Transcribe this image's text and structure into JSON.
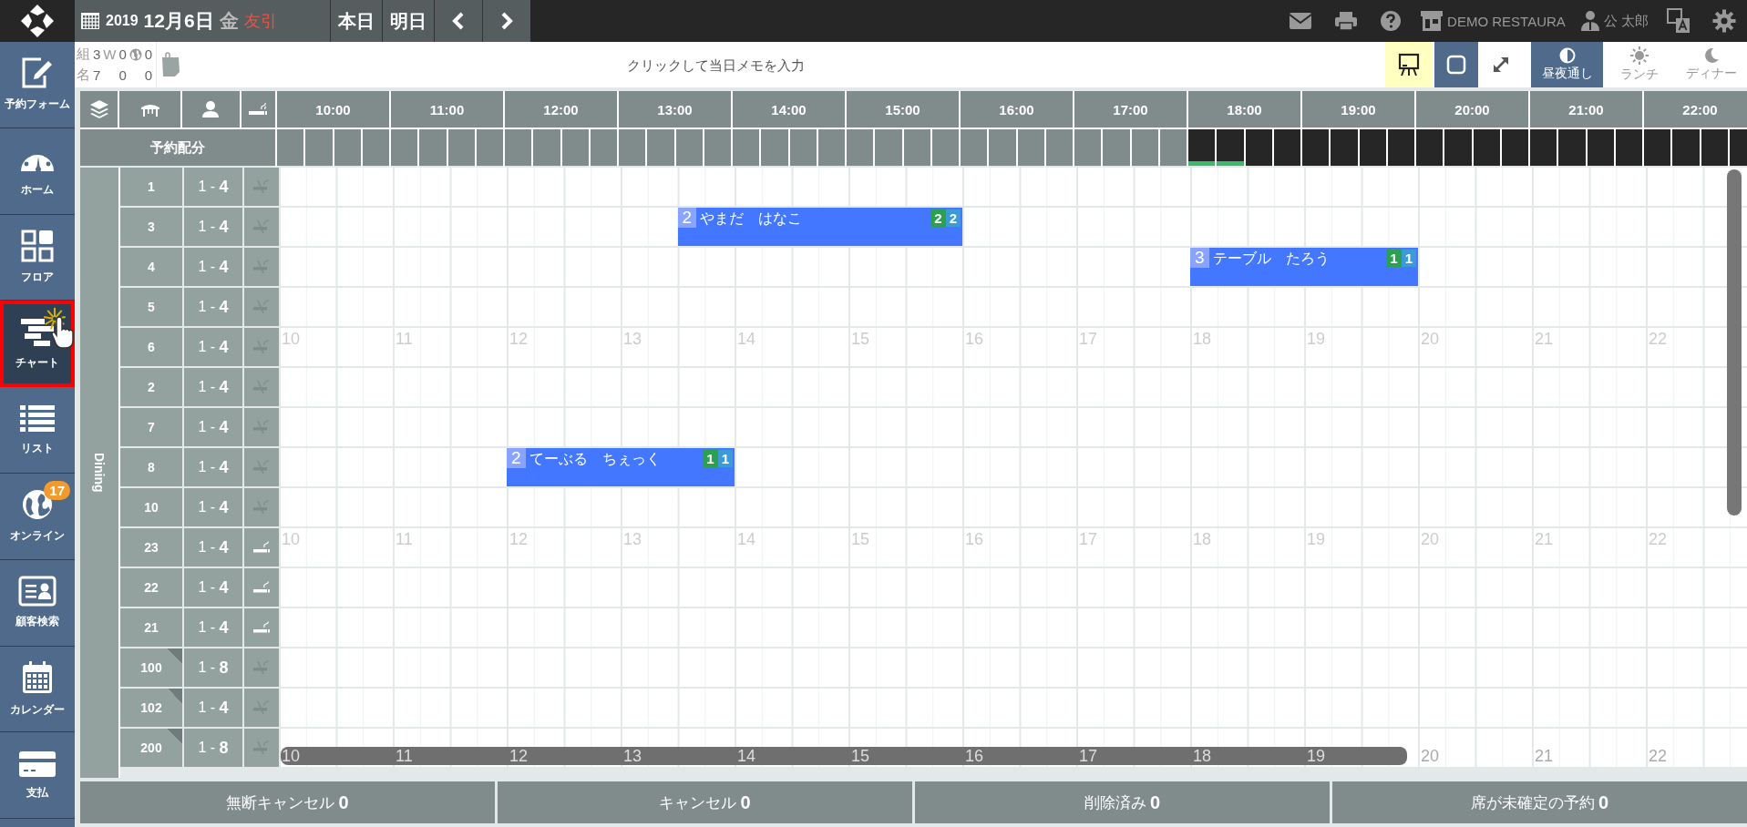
{
  "top_bar": {
    "year": "2019",
    "date": "12月6日",
    "weekday": "金",
    "rokuyo": "友引",
    "nav_buttons": [
      {
        "kind": "text",
        "label": "本日"
      },
      {
        "kind": "text",
        "label": "明日"
      },
      {
        "kind": "prev"
      },
      {
        "kind": "next"
      }
    ],
    "tools": [
      {
        "kind": "mail"
      },
      {
        "kind": "print"
      },
      {
        "kind": "help"
      },
      {
        "kind": "store",
        "label": "DEMO RESTAURA"
      },
      {
        "kind": "user",
        "label": "公 太郎"
      },
      {
        "kind": "translate"
      },
      {
        "kind": "settings"
      }
    ]
  },
  "sidebar": {
    "items": [
      {
        "kind": "form",
        "label": "予約フォーム",
        "selected": false
      },
      {
        "kind": "home",
        "label": "ホーム",
        "selected": false
      },
      {
        "kind": "floor",
        "label": "フロア",
        "selected": false
      },
      {
        "kind": "chart",
        "label": "チャート",
        "selected": true
      },
      {
        "kind": "list",
        "label": "リスト",
        "selected": false
      },
      {
        "kind": "online",
        "label": "オンライン",
        "selected": false,
        "badge": "17"
      },
      {
        "kind": "customer",
        "label": "顧客検索",
        "selected": false
      },
      {
        "kind": "calendar",
        "label": "カレンダー",
        "selected": false
      },
      {
        "kind": "payment",
        "label": "支払",
        "selected": false
      }
    ]
  },
  "summary": {
    "walkin_label": "W",
    "rows": [
      {
        "label": "組",
        "total": "3",
        "walkin": "0",
        "online": "0"
      },
      {
        "label": "名",
        "total": "7",
        "walkin": "0",
        "online": "0"
      }
    ]
  },
  "memo": {
    "placeholder": "クリックして当日メモを入力"
  },
  "view_buttons": [
    {
      "kind": "board"
    },
    {
      "kind": "square"
    },
    {
      "kind": "expand"
    }
  ],
  "periods": [
    {
      "kind": "both",
      "label": "昼夜通し",
      "selected": true
    },
    {
      "kind": "lunch",
      "label": "ランチ",
      "selected": false
    },
    {
      "kind": "dinner",
      "label": "ディナー",
      "selected": false
    }
  ],
  "chart": {
    "allocation_label": "予約配分",
    "area": "Dining",
    "hours": [
      {
        "label": "10:00",
        "slots": [
          {
            "closed": false,
            "booked": false
          },
          {
            "closed": false,
            "booked": false
          },
          {
            "closed": false,
            "booked": false
          },
          {
            "closed": false,
            "booked": false
          }
        ]
      },
      {
        "label": "11:00",
        "slots": [
          {
            "closed": false,
            "booked": false
          },
          {
            "closed": false,
            "booked": false
          },
          {
            "closed": false,
            "booked": false
          },
          {
            "closed": false,
            "booked": false
          }
        ]
      },
      {
        "label": "12:00",
        "slots": [
          {
            "closed": false,
            "booked": false
          },
          {
            "closed": false,
            "booked": false
          },
          {
            "closed": false,
            "booked": false
          },
          {
            "closed": false,
            "booked": false
          }
        ]
      },
      {
        "label": "13:00",
        "slots": [
          {
            "closed": false,
            "booked": false
          },
          {
            "closed": false,
            "booked": false
          },
          {
            "closed": false,
            "booked": false
          },
          {
            "closed": false,
            "booked": false
          }
        ]
      },
      {
        "label": "14:00",
        "slots": [
          {
            "closed": false,
            "booked": false
          },
          {
            "closed": false,
            "booked": false
          },
          {
            "closed": false,
            "booked": false
          },
          {
            "closed": false,
            "booked": false
          }
        ]
      },
      {
        "label": "15:00",
        "slots": [
          {
            "closed": false,
            "booked": false
          },
          {
            "closed": false,
            "booked": false
          },
          {
            "closed": false,
            "booked": false
          },
          {
            "closed": false,
            "booked": false
          }
        ]
      },
      {
        "label": "16:00",
        "slots": [
          {
            "closed": false,
            "booked": false
          },
          {
            "closed": false,
            "booked": false
          },
          {
            "closed": false,
            "booked": false
          },
          {
            "closed": false,
            "booked": false
          }
        ]
      },
      {
        "label": "17:00",
        "slots": [
          {
            "closed": false,
            "booked": false
          },
          {
            "closed": false,
            "booked": false
          },
          {
            "closed": false,
            "booked": false
          },
          {
            "closed": false,
            "booked": false
          }
        ]
      },
      {
        "label": "18:00",
        "slots": [
          {
            "closed": true,
            "booked": true
          },
          {
            "closed": true,
            "booked": true
          },
          {
            "closed": true,
            "booked": false
          },
          {
            "closed": true,
            "booked": false
          }
        ]
      },
      {
        "label": "19:00",
        "slots": [
          {
            "closed": true,
            "booked": false
          },
          {
            "closed": true,
            "booked": false
          },
          {
            "closed": true,
            "booked": false
          },
          {
            "closed": true,
            "booked": false
          }
        ]
      },
      {
        "label": "20:00",
        "slots": [
          {
            "closed": true,
            "booked": false
          },
          {
            "closed": true,
            "booked": false
          },
          {
            "closed": true,
            "booked": false
          },
          {
            "closed": true,
            "booked": false
          }
        ]
      },
      {
        "label": "21:00",
        "slots": [
          {
            "closed": true,
            "booked": false
          },
          {
            "closed": true,
            "booked": false
          },
          {
            "closed": true,
            "booked": false
          },
          {
            "closed": true,
            "booked": false
          }
        ]
      },
      {
        "label": "22:00",
        "slots": [
          {
            "closed": true,
            "booked": false
          },
          {
            "closed": true,
            "booked": false
          },
          {
            "closed": true,
            "booked": false
          },
          {
            "closed": true,
            "booked": false
          }
        ]
      }
    ],
    "tables": [
      {
        "number": "1",
        "capacity": "1 - **4**",
        "smoking": false,
        "linked": false
      },
      {
        "number": "3",
        "capacity": "1 - **4**",
        "smoking": false,
        "linked": false,
        "reservations": [
          {
            "start": {
              "level": 0.269231
            },
            "end": {
              "level": 0.461538
            },
            "party": "2",
            "name": "やまだ　はなこ",
            "badges": [
              "2",
              "2"
            ]
          }
        ]
      },
      {
        "number": "4",
        "capacity": "1 - **4**",
        "smoking": false,
        "linked": false,
        "reservations": [
          {
            "start": {
              "level": 0.615385
            },
            "end": {
              "level": 0.769231
            },
            "party": "3",
            "name": "テーブル　たろう",
            "badges": [
              "1",
              "1"
            ]
          }
        ]
      },
      {
        "number": "5",
        "capacity": "1 - **4**",
        "smoking": false,
        "linked": false
      },
      {
        "number": "6",
        "capacity": "1 - **4**",
        "smoking": false,
        "linked": false,
        "hour_marks": [
          "10",
          "11",
          "12",
          "13",
          "14",
          "15",
          "16",
          "17",
          "18",
          "19",
          "20",
          "21",
          "22"
        ]
      },
      {
        "number": "2",
        "capacity": "1 - **4**",
        "smoking": false,
        "linked": false
      },
      {
        "number": "7",
        "capacity": "1 - **4**",
        "smoking": false,
        "linked": false
      },
      {
        "number": "8",
        "capacity": "1 - **4**",
        "smoking": false,
        "linked": false,
        "reservations": [
          {
            "start": {
              "level": 0.153846
            },
            "end": {
              "level": 0.307692
            },
            "party": "2",
            "name": "てーぶる　ちぇっく",
            "badges": [
              "1",
              "1"
            ]
          }
        ]
      },
      {
        "number": "10",
        "capacity": "1 - **4**",
        "smoking": false,
        "linked": false
      },
      {
        "number": "23",
        "capacity": "1 - **4**",
        "smoking": true,
        "linked": false,
        "hour_marks": [
          "10",
          "11",
          "12",
          "13",
          "14",
          "15",
          "16",
          "17",
          "18",
          "19",
          "20",
          "21",
          "22"
        ]
      },
      {
        "number": "22",
        "capacity": "1 - **4**",
        "smoking": true,
        "linked": false
      },
      {
        "number": "21",
        "capacity": "1 - **4**",
        "smoking": true,
        "linked": false
      },
      {
        "number": "100",
        "capacity": "1 - **8**",
        "smoking": false,
        "linked": true
      },
      {
        "number": "102",
        "capacity": "1 - **4**",
        "smoking": false,
        "linked": true
      },
      {
        "number": "200",
        "capacity": "1 - **8**",
        "smoking": false,
        "linked": true,
        "hour_marks": [
          "10",
          "11",
          "12",
          "13",
          "14",
          "15",
          "16",
          "17",
          "18",
          "19",
          "20",
          "21",
          "22"
        ],
        "scrollbar": true
      }
    ]
  },
  "footer": [
    {
      "label": "無断キャンセル",
      "count": "0"
    },
    {
      "label": "キャンセル",
      "count": "0"
    },
    {
      "label": "削除済み",
      "count": "0"
    },
    {
      "label": "席が未確定の予約",
      "count": "0"
    }
  ]
}
